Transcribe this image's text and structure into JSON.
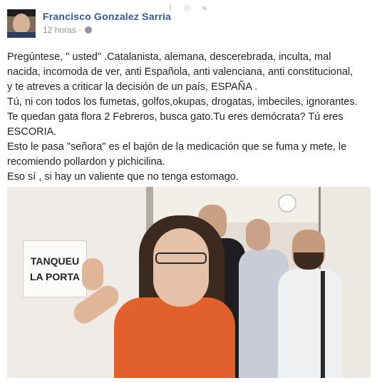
{
  "share_icons": [
    {
      "name": "facebook-icon",
      "glyph": "f"
    },
    {
      "name": "pinterest-icon",
      "glyph": "℗"
    },
    {
      "name": "twitter-icon",
      "glyph": "❧"
    }
  ],
  "post": {
    "author": "Francisco Gonzalez Sarria",
    "time": "12 horas ·",
    "lines": [
      "Pregúntese, \" usted\" .Catalanista, alemana, descerebrada, inculta, mal",
      "nacida, incomoda de ver, anti Española, anti valenciana, anti constitucional,",
      "y te atreves a criticar la decisión de un país, ESPAÑA .",
      "Tú, ni con todos los fumetas, golfos,okupas, drogatas, imbeciles, ignorantes.",
      "Te quedan gata flora 2 Febreros, busca gato.Tu eres demócrata? Tú eres",
      "ESCORIA.",
      "Esto le pasa \"señora\" es el bajón de la medicación que se fuma y mete, le",
      "recomiendo pollardon y pichicilina.",
      "Eso sí , si hay un valiente que no tenga estomago."
    ]
  },
  "photo": {
    "sign_line1": "TANQUEU",
    "sign_line2": "LA PORTA"
  },
  "colors": {
    "author": "#365899",
    "meta": "#90949c",
    "text": "#1d2129",
    "dress": "#e1602b"
  }
}
